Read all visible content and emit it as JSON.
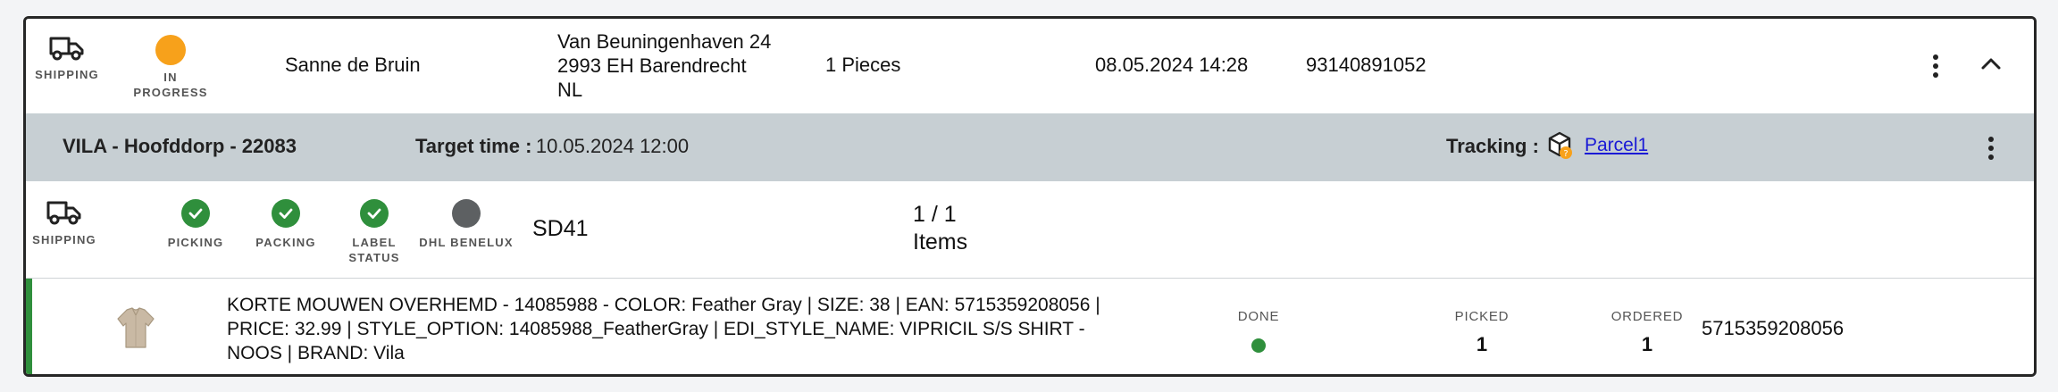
{
  "order": {
    "shipping_label": "SHIPPING",
    "status_line1": "IN",
    "status_line2": "PROGRESS",
    "status_color": "#f7a11b",
    "customer": "Sanne de Bruin",
    "address_line1": "Van Beuningenhaven 24",
    "address_line2": "2993 EH Barendrecht",
    "address_line3": "NL",
    "pieces": "1 Pieces",
    "datetime": "08.05.2024 14:28",
    "order_number": "93140891052"
  },
  "shipment": {
    "store": "VILA - Hoofddorp - 22083",
    "target_label": "Target time :",
    "target_value": "10.05.2024 12:00",
    "tracking_label": "Tracking :",
    "parcel_link": "Parcel1",
    "band_color": "#c7cfd3"
  },
  "steps": {
    "shipping": "SHIPPING",
    "picking": "PICKING",
    "packing": "PACKING",
    "label_line1": "LABEL",
    "label_line2": "STATUS",
    "carrier": "DHL BENELUX",
    "station": "SD41",
    "items_count": "1 / 1",
    "items_label": "Items",
    "done_color": "#2f8f3c"
  },
  "item": {
    "desc_line1": "KORTE MOUWEN OVERHEMD - 14085988 - COLOR: Feather Gray | SIZE: 38 | EAN: 5715359208056 |",
    "desc_line2": "PRICE: 32.99 | STYLE_OPTION: 14085988_FeatherGray | EDI_STYLE_NAME: VIPRICIL S/S SHIRT -",
    "desc_line3": "NOOS | BRAND: Vila",
    "done_head": "DONE",
    "picked_head": "PICKED",
    "picked_val": "1",
    "ordered_head": "ORDERED",
    "ordered_val": "1",
    "ean": "5715359208056"
  },
  "icons": {
    "truck": "truck-icon",
    "check": "check-circle-icon",
    "kebab": "more-vertical-icon",
    "chevron": "chevron-up-icon",
    "package": "package-icon",
    "shirt": "shirt-thumbnail"
  }
}
